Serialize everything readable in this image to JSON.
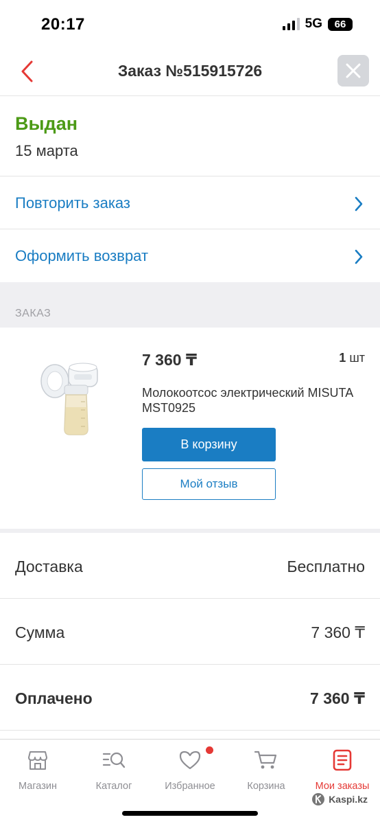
{
  "status_bar": {
    "time": "20:17",
    "network": "5G",
    "battery": "66"
  },
  "header": {
    "title": "Заказ №515915726",
    "back_icon": "chevron-left-icon",
    "close_icon": "close-icon"
  },
  "order_status": {
    "label": "Выдан",
    "date": "15 марта",
    "color": "#4c9a16"
  },
  "actions": [
    {
      "label": "Повторить заказ",
      "icon": "chevron-right-icon"
    },
    {
      "label": "Оформить возврат",
      "icon": "chevron-right-icon"
    }
  ],
  "order_section": {
    "title": "ЗАКАЗ"
  },
  "product": {
    "price": "7 360 ₸",
    "qty_number": "1",
    "qty_unit": "шт",
    "name": "Молокоотсос электрический MISUTA MST0925",
    "cart_button": "В корзину",
    "review_button": "Мой отзыв"
  },
  "summary": {
    "delivery_label": "Доставка",
    "delivery_value": "Бесплатно",
    "sum_label": "Сумма",
    "sum_value": "7 360 ₸",
    "paid_label": "Оплачено",
    "paid_value": "7 360 ₸"
  },
  "tabbar": {
    "shop": "Магазин",
    "catalog": "Каталог",
    "favorites": "Избранное",
    "cart": "Корзина",
    "orders": "Мои заказы"
  },
  "watermark": "Kaspi.kz",
  "colors": {
    "accent": "#1a7dc3",
    "brand_red": "#e53935",
    "success": "#4c9a16"
  }
}
